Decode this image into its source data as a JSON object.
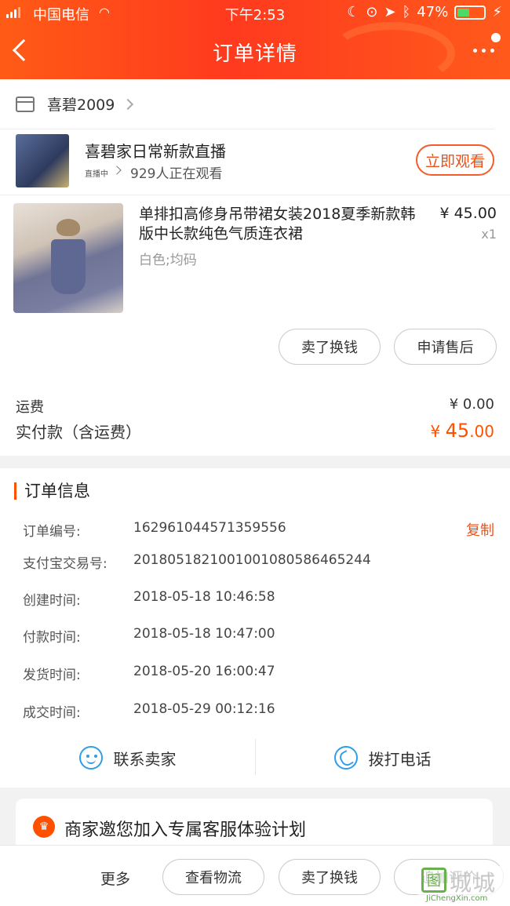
{
  "status_bar": {
    "carrier": "中国电信",
    "time": "下午2:53",
    "battery": "47%",
    "battery_level": 0.47
  },
  "header": {
    "title": "订单详情"
  },
  "shop": {
    "name": "喜碧2009"
  },
  "live": {
    "title": "喜碧家日常新款直播",
    "badge": "直播中",
    "viewers": "929人正在观看",
    "watch_button": "立即观看"
  },
  "product": {
    "name": "单排扣高修身吊带裙女装2018夏季新款韩版中长款纯色气质连衣裙",
    "sku": "白色;均码",
    "price": "¥ 45.00",
    "qty": "x1",
    "actions": [
      "卖了换钱",
      "申请售后"
    ]
  },
  "fees": {
    "shipping_label": "运费",
    "shipping_value": "¥ 0.00",
    "paid_label": "实付款（含运费）",
    "paid_currency": "¥ ",
    "paid_int": "45",
    "paid_dec": ".00"
  },
  "order_info": {
    "title": "订单信息",
    "copy_label": "复制",
    "rows": [
      {
        "label": "订单编号:",
        "value": "162961044571359556"
      },
      {
        "label": "支付宝交易号:",
        "value": "2018051821001001080586465244"
      },
      {
        "label": "创建时间:",
        "value": "2018-05-18 10:46:58"
      },
      {
        "label": "付款时间:",
        "value": "2018-05-18 10:47:00"
      },
      {
        "label": "发货时间:",
        "value": "2018-05-20 16:00:47"
      },
      {
        "label": "成交时间:",
        "value": "2018-05-29 00:12:16"
      }
    ]
  },
  "contact": {
    "seller": "联系卖家",
    "call": "拨打电话"
  },
  "invite": {
    "text": "商家邀您加入专属客服体验计划"
  },
  "bottom_bar": {
    "more": "更多",
    "buttons": [
      "查看物流",
      "卖了换钱",
      "追加评价"
    ]
  },
  "watermark": {
    "logo": "图",
    "text": "城城",
    "url": "JiChengXin.com"
  },
  "colors": {
    "accent": "#ff5000",
    "header_start": "#ff5b16",
    "header_end": "#ff3a1e",
    "link_blue": "#2f9ee8"
  }
}
